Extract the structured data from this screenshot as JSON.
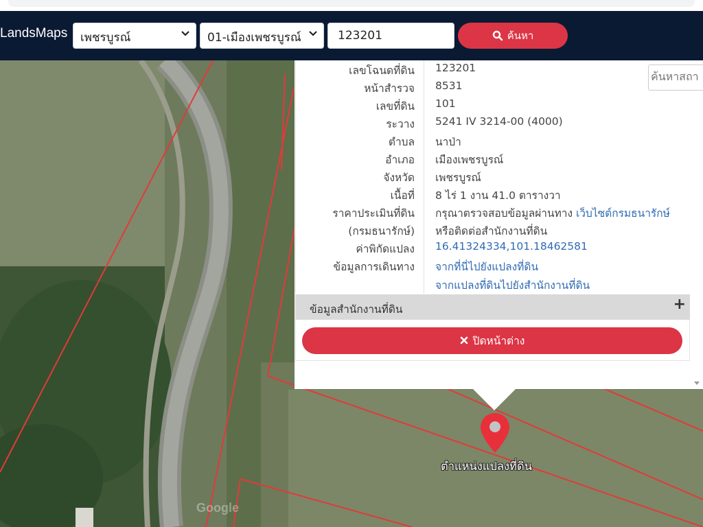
{
  "navbar": {
    "brand": "LandsMaps",
    "province_select": "เพชรบูรณ์",
    "district_select": "01-เมืองเพชรบูรณ์",
    "deed_number_input": "123201",
    "search_button": "ค้นหา"
  },
  "map": {
    "search_placeholder": "ค้นหาสถา",
    "pin_label": "ตำแหน่งแปลงที่ดิน",
    "watermark": "Google"
  },
  "popup": {
    "rows": [
      {
        "label": "เลขโฉนดที่ดิน",
        "value": "123201"
      },
      {
        "label": "หน้าสำรวจ",
        "value": "8531"
      },
      {
        "label": "เลขที่ดิน",
        "value": "101"
      },
      {
        "label": "ระวาง",
        "value": "5241 IV 3214-00 (4000)"
      },
      {
        "label": "ตำบล",
        "value": "นาป่า"
      },
      {
        "label": "อำเภอ",
        "value": "เมืองเพชรบูรณ์"
      },
      {
        "label": "จังหวัด",
        "value": "เพชรบูรณ์"
      },
      {
        "label": "เนื้อที่",
        "value": "8 ไร่ 1 งาน 41.0 ตารางวา"
      }
    ],
    "appraisal": {
      "label": "ราคาประเมินที่ดิน",
      "label2": "(กรมธนารักษ์)",
      "value_prefix": "กรุณาตรวจสอบข้อมูลผ่านทาง ",
      "value_link": "เว็บไซต์กรมธนารักษ์",
      "value_line2": "หรือติดต่อสำนักงานที่ดิน"
    },
    "coordinates": {
      "label": "ค่าพิกัดแปลง",
      "value": "16.41324334,101.18462581"
    },
    "directions": {
      "label": "ข้อมูลการเดินทาง",
      "link1": "จากที่นี่ไปยังแปลงที่ดิน",
      "link2": "จากแปลงที่ดินไปยังสำนักงานที่ดิน"
    },
    "office_section": "ข้อมูลสำนักงานที่ดิน",
    "office_expand": "+",
    "close_button": "ปิดหน้าต่าง"
  },
  "colors": {
    "navbar": "#0b1a33",
    "accent": "#dc3545",
    "link": "#2f6bb3"
  }
}
